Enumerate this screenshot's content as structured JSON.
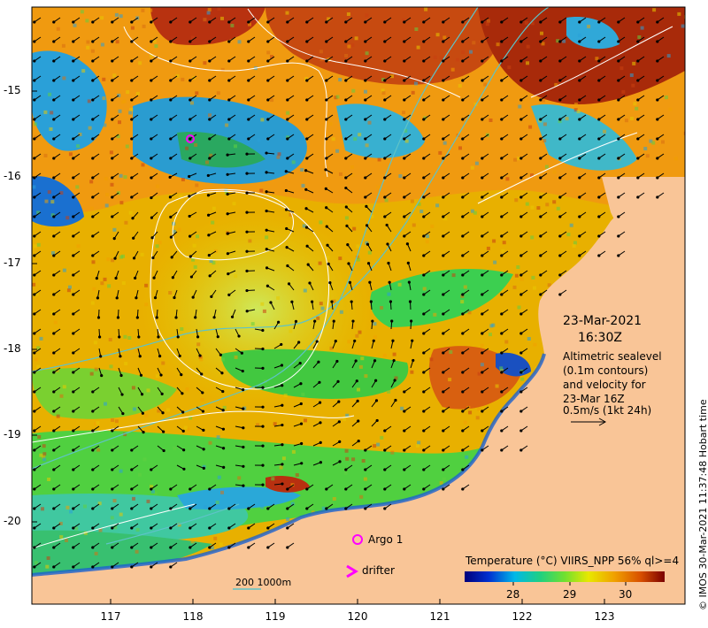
{
  "map": {
    "date": "23-Mar-2021",
    "time": "16:30Z",
    "description_lines": [
      "Altimetric sealevel",
      "(0.1m contours)",
      "and velocity for",
      "23-Mar 16Z",
      "0.5m/s (1kt 24h)"
    ],
    "legend_argo": "Argo 1",
    "legend_drifter": "drifter",
    "depth_scale_label": "200  1000m",
    "colorbar_title": "Temperature (°C) VIIRS_NPP 56% ql>=4",
    "colorbar_ticks": [
      "28",
      "29",
      "30"
    ],
    "credit": "© IMOS 30-Mar-2021 11:37:48 Hobart time",
    "latitude_labels": [
      "-15",
      "-16",
      "-17",
      "-18",
      "-19",
      "-20"
    ],
    "longitude_labels": [
      "117",
      "118",
      "119",
      "120",
      "121",
      "122",
      "123"
    ],
    "land_color": "#f9c597",
    "current_color": "#000000",
    "contour_color": "#ffffff",
    "isobath_color": "#5ec3c8",
    "argo_marker_color": "#ff00ff"
  }
}
